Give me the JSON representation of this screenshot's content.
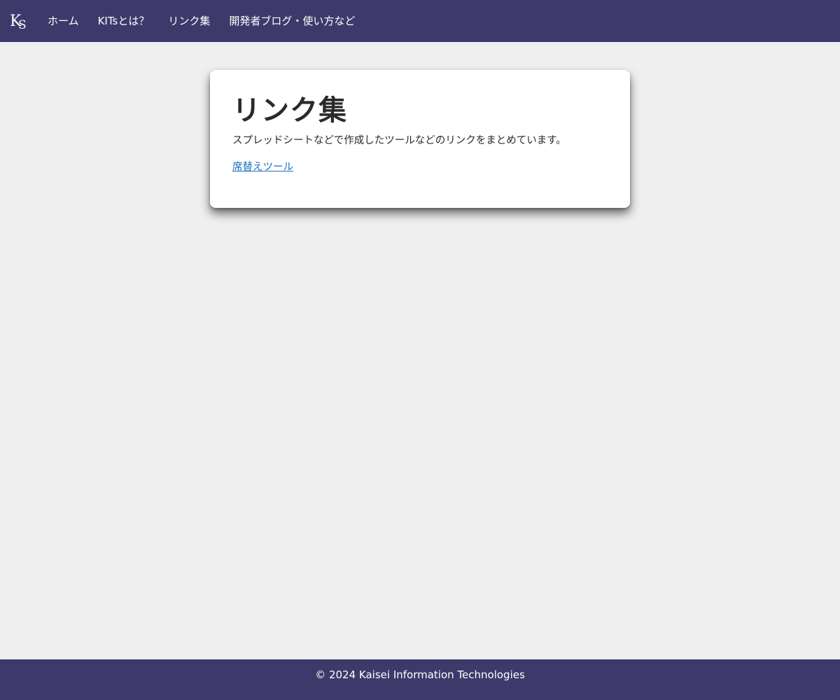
{
  "nav": {
    "logo_text": "KS",
    "items": [
      {
        "label": "ホーム"
      },
      {
        "label": "KITsとは？"
      },
      {
        "label": "リンク集"
      },
      {
        "label": "開発者ブログ・使い方など"
      }
    ]
  },
  "main": {
    "title": "リンク集",
    "description": "スプレッドシートなどで作成したツールなどのリンクをまとめています。",
    "links": [
      {
        "label": "席替えツール"
      }
    ]
  },
  "footer": {
    "copyright": "© 2024 Kaisei Information Technologies"
  },
  "colors": {
    "nav_background": "#3d3a6b",
    "page_background": "#efefef",
    "link": "#1a6fc4"
  }
}
